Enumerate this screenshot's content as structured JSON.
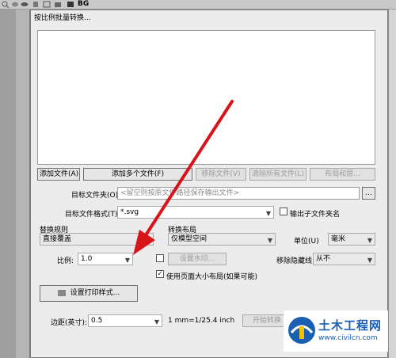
{
  "host": {
    "layer_label": "BG"
  },
  "dialog": {
    "title": "按比例批量转换...",
    "buttons": {
      "add_file": "添加文件(A)",
      "add_multiple": "添加多个文件(F)",
      "remove_file": "移除文件(V)",
      "clear_all": "清除所有文件(L)",
      "layout_more": "布局和层..."
    },
    "target_folder": {
      "label": "目标文件夹(O)",
      "placeholder": "<留空则按原文件路径保存输出文件>",
      "browse": "..."
    },
    "target_format": {
      "label": "目标文件格式(T)",
      "value": "*.svg",
      "subfolder_label": "输出子文件夹名"
    },
    "replace_rule": {
      "label": "替换规则",
      "value": "直接覆盖"
    },
    "convert_layout": {
      "label": "转换布局",
      "value": "仅模型空间"
    },
    "unit": {
      "label": "单位(U)",
      "value": "毫米"
    },
    "scale": {
      "label": "比例:",
      "value": "1.0"
    },
    "watermark_button": "设置水印...",
    "hide_line": {
      "label": "移除隐藏线",
      "value": "从不"
    },
    "use_page_size": {
      "label": "使用页面大小布局(如果可能)",
      "checked": true
    },
    "print_style_button": "设置打印样式...",
    "margin": {
      "label": "边距(英寸):",
      "value": "0.5",
      "conversion": "1 mm=1/25.4 inch"
    },
    "start_button": "开始转换"
  },
  "watermark": {
    "title": "土木工程网",
    "url": "www.civilcn.com"
  }
}
